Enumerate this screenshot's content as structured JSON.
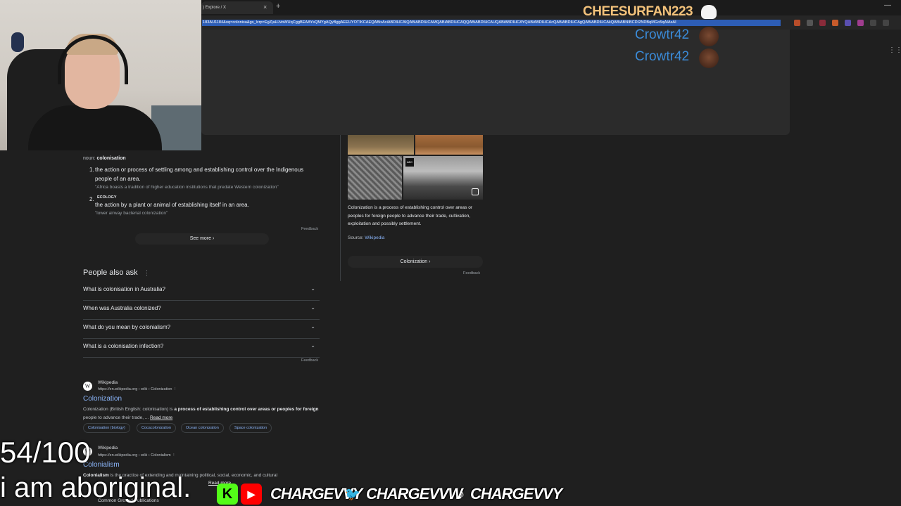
{
  "browser": {
    "tab_title": ") Explore / X",
    "tab_close": "×",
    "new_tab": "+",
    "minimize": "—",
    "url": "183AU1184&oq=colonisa&gs_lcrp=EgZjaHJvbWUqCggBEAAYsQMYgAQyBggAEEUYOTIKCAEQABixAxiABDIHCAIQABiABDIHCAMQABiABDIHCAQQABiABDIHCAUQABiABDIHCAYQABiABDIHCAcQABiABDIHCAgQABiABDIHCAkQABiABNIBCDI2NDBqMGo5qAIAsAI",
    "apps_icon": "⋮⋮⋮"
  },
  "dictionary": {
    "noun_label": "noun: ",
    "noun_word": "colonisation",
    "def1_num": "1.",
    "def1": "the action or process of settling among and establishing control over the Indigenous people of an area.",
    "def1_example": "\"Africa boasts a tradition of higher education institutions that predate Western colonization\"",
    "def2_num": "2.",
    "def2_label": "ECOLOGY",
    "def2": "the action by a plant or animal of establishing itself in an area.",
    "def2_example": "\"lower airway bacterial colonization\"",
    "feedback": "Feedback",
    "see_more": "See more  ›"
  },
  "people_also_ask": {
    "title": "People also ask",
    "menu": "⋮",
    "questions": [
      "What is colonisation in Australia?",
      "When was Australia colonized?",
      "What do you mean by colonialism?",
      "What is a colonisation infection?"
    ],
    "chevron": "⌄",
    "feedback": "Feedback"
  },
  "results": [
    {
      "favicon": "W",
      "site": "Wikipedia",
      "crumb": "https://en.wikipedia.org › wiki › Colonization  ⋮",
      "title": "Colonization",
      "snippet_a": "Colonization (British English: colonisation) is ",
      "snippet_bold": "a process of establishing control over areas or peoples for foreign",
      "snippet_b": " people to advance their trade, ... ",
      "read_more": "Read more",
      "chips": [
        "Colonisation (biology)",
        "Cocacolonization",
        "Ocean colonization",
        "Space colonization"
      ]
    },
    {
      "favicon": "W",
      "site": "Wikipedia",
      "crumb": "https://en.wikipedia.org › wiki › Colonialism  ⋮",
      "title": "Colonialism",
      "snippet_bold": "Colonialism",
      "snippet_a": " is the practice of extending and maintaining political, social, economic, and cultural",
      "read_more": "Read more"
    }
  ],
  "partial_result": "Common Ground Publications",
  "knowledge_panel": {
    "description": "Colonization is a process of establishing control over areas or peoples for foreign people to advance their trade, cultivation, exploitation and possibly settlement.",
    "source_label": "Source: ",
    "source": "Wikipedia",
    "button": "Colonization  ›",
    "feedback": "Feedback",
    "badge": "ABC"
  },
  "overlay": {
    "subscriber": "CHEESURFAN223",
    "chatters": [
      "Crowtr42",
      "Crowtr42"
    ],
    "goal": "54/100",
    "tagline": "i am aboriginal.",
    "handles": [
      "CHARGEVVY",
      "CHARGEVVW",
      "CHARGEVVY"
    ],
    "kick_icon": "K",
    "youtube_icon": "▶",
    "twitter_icon": "🐦",
    "tiktok_icon": "♪"
  },
  "colors": {
    "page_bg": "#1f1f1f",
    "link": "#8ab4f8",
    "subscriber": "#f3c27b",
    "chatter": "#3b8bd8",
    "url_highlight": "#2d5db5"
  }
}
